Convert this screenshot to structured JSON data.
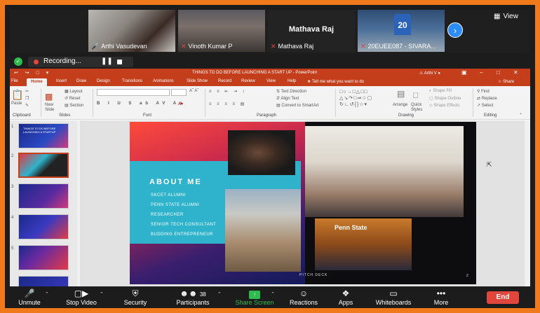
{
  "participants": [
    {
      "name": "Arthi Vasudevan",
      "muted": false
    },
    {
      "name": "Vinoth Kumar P",
      "muted": true
    },
    {
      "name": "Mathava Raj",
      "muted": true,
      "big_label": "Mathava Raj"
    },
    {
      "name": "20EUEE087 - SIVARA...",
      "muted": true,
      "jersey": "20"
    }
  ],
  "view_label": "View",
  "recording_label": "Recording...",
  "ppt": {
    "window_title": "THINGS TO DO BEFORE LAUNCHING A START UP - PowerPoint",
    "user": "Arthi V",
    "tabs": [
      "File",
      "Home",
      "Insert",
      "Draw",
      "Design",
      "Transitions",
      "Animations",
      "Slide Show",
      "Record",
      "Review",
      "View",
      "Help",
      "Tell me what you want to do"
    ],
    "active_tab": "Home",
    "share_label": "Share",
    "ribbon": {
      "groups": [
        "Clipboard",
        "Slides",
        "Font",
        "Paragraph",
        "Drawing",
        "Editing"
      ],
      "slides_items": [
        "Layout",
        "Reset",
        "Section"
      ],
      "new_slide": "New Slide",
      "paste": "Paste",
      "text_direction": "Text Direction",
      "align_text": "Align Text",
      "convert_smartart": "Convert to SmartArt",
      "arrange": "Arrange",
      "quick_styles": "Quick Styles",
      "shape_fill": "Shape Fill",
      "shape_outline": "Shape Outline",
      "shape_effects": "Shape Effects",
      "find": "Find",
      "replace": "Replace",
      "select": "Select"
    },
    "thumbnail_first_title": "THINGS TO DO BEFORE LAUNCHING A STARTUP",
    "slide": {
      "heading": "ABOUT ME",
      "roles": [
        "SKCET ALUMNI",
        "PENN STATE ALUMNI",
        "RESEARCHER",
        "SENIOR TECH CONSULTANT",
        "BUDDING ENTREPRENEUR"
      ],
      "footer": "PITCH DECK",
      "page_number": "2",
      "banner_text": "Penn State"
    }
  },
  "toolbar": {
    "unmute": "Unmute",
    "stop_video": "Stop Video",
    "security": "Security",
    "participants": "Participants",
    "participant_count": "38",
    "share_screen": "Share Screen",
    "reactions": "Reactions",
    "apps": "Apps",
    "whiteboards": "Whiteboards",
    "more": "More",
    "end": "End"
  },
  "colors": {
    "frame": "#f07a1b",
    "ppt_red": "#c43e1c",
    "zoom_green": "#2fbb4e",
    "zoom_blue": "#2d8cff",
    "end_red": "#e0463c"
  }
}
